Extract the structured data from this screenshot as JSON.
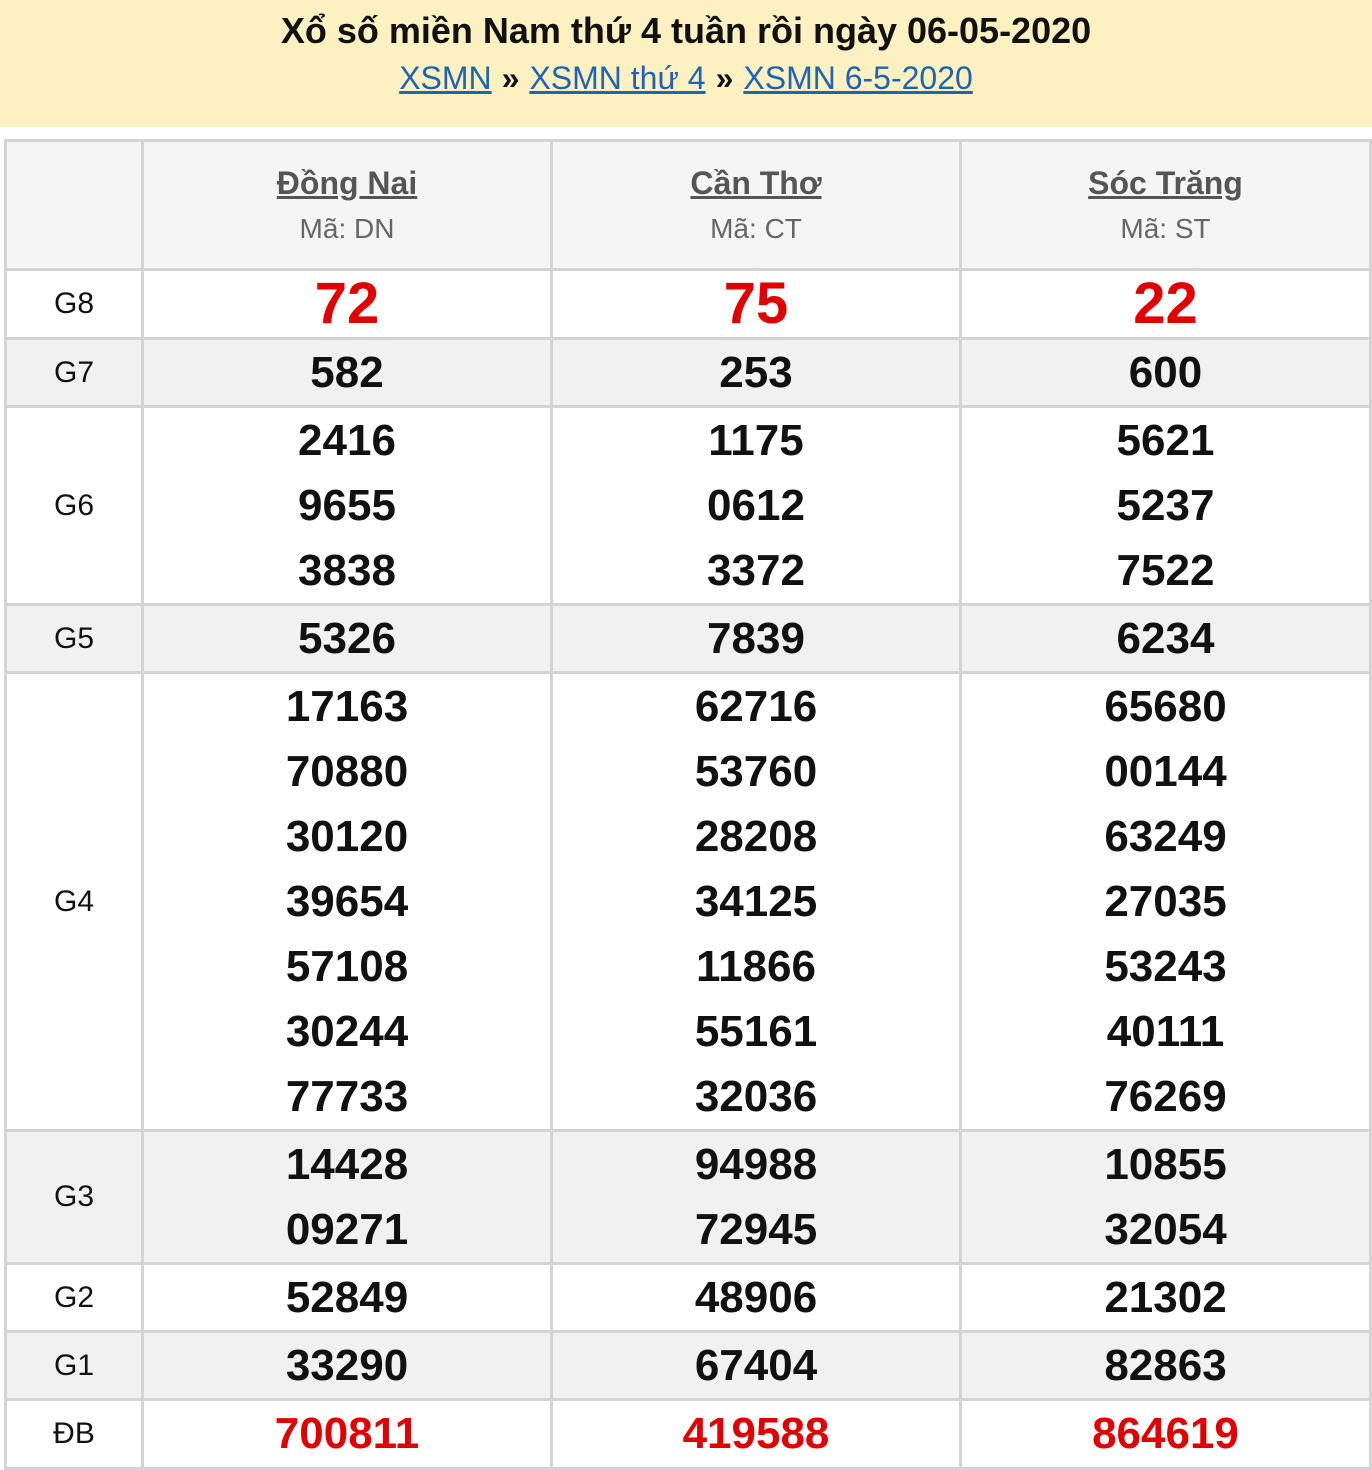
{
  "header": {
    "title": "Xổ số miền Nam thứ 4 tuần rồi ngày 06-05-2020",
    "breadcrumbs": [
      "XSMN",
      "XSMN thứ 4",
      "XSMN 6-5-2020"
    ],
    "separator": "»"
  },
  "provinces": [
    {
      "name": "Đồng Nai",
      "code": "Mã: DN"
    },
    {
      "name": "Cần Thơ",
      "code": "Mã: CT"
    },
    {
      "name": "Sóc Trăng",
      "code": "Mã: ST"
    }
  ],
  "prizes": {
    "g8": {
      "label": "G8",
      "values": [
        [
          "72"
        ],
        [
          "75"
        ],
        [
          "22"
        ]
      ]
    },
    "g7": {
      "label": "G7",
      "values": [
        [
          "582"
        ],
        [
          "253"
        ],
        [
          "600"
        ]
      ]
    },
    "g6": {
      "label": "G6",
      "values": [
        [
          "2416",
          "9655",
          "3838"
        ],
        [
          "1175",
          "0612",
          "3372"
        ],
        [
          "5621",
          "5237",
          "7522"
        ]
      ]
    },
    "g5": {
      "label": "G5",
      "values": [
        [
          "5326"
        ],
        [
          "7839"
        ],
        [
          "6234"
        ]
      ]
    },
    "g4": {
      "label": "G4",
      "values": [
        [
          "17163",
          "70880",
          "30120",
          "39654",
          "57108",
          "30244",
          "77733"
        ],
        [
          "62716",
          "53760",
          "28208",
          "34125",
          "11866",
          "55161",
          "32036"
        ],
        [
          "65680",
          "00144",
          "63249",
          "27035",
          "53243",
          "40111",
          "76269"
        ]
      ]
    },
    "g3": {
      "label": "G3",
      "values": [
        [
          "14428",
          "09271"
        ],
        [
          "94988",
          "72945"
        ],
        [
          "10855",
          "32054"
        ]
      ]
    },
    "g2": {
      "label": "G2",
      "values": [
        [
          "52849"
        ],
        [
          "48906"
        ],
        [
          "21302"
        ]
      ]
    },
    "g1": {
      "label": "G1",
      "values": [
        [
          "33290"
        ],
        [
          "67404"
        ],
        [
          "82863"
        ]
      ]
    },
    "db": {
      "label": "ĐB",
      "values": [
        [
          "700811"
        ],
        [
          "419588"
        ],
        [
          "864619"
        ]
      ]
    }
  },
  "colors": {
    "header_bg": "#fdf1c2",
    "link": "#1e63b6",
    "highlight_red": "#e10000",
    "row_shade": "#f1f1f1",
    "border": "#d4d4d4"
  }
}
